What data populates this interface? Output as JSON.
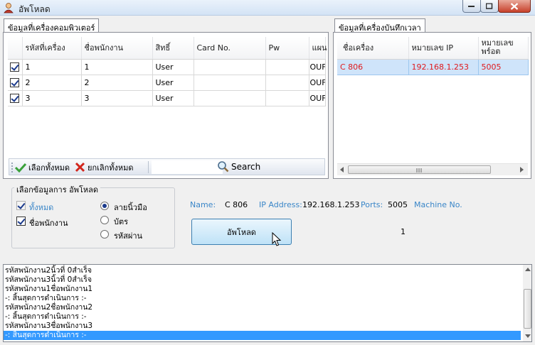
{
  "window": {
    "title": "อัพโหลด"
  },
  "left_tab": {
    "label": "ข้อมูลที่เครื่องคอมพิวเตอร์",
    "columns": [
      "",
      "รหัสที่เครื่อง",
      "ชื่อพนักงาน",
      "สิทธิ์",
      "Card No.",
      "Pw",
      "แผน"
    ],
    "rows": [
      {
        "checked": true,
        "id": "1",
        "name": "1",
        "role": "User",
        "card": "",
        "pw": "",
        "dept": "OUF"
      },
      {
        "checked": true,
        "id": "2",
        "name": "2",
        "role": "User",
        "card": "",
        "pw": "",
        "dept": "OUF"
      },
      {
        "checked": true,
        "id": "3",
        "name": "3",
        "role": "User",
        "card": "",
        "pw": "",
        "dept": "OUF"
      }
    ],
    "toolbar": {
      "select_all": "เลือกทั้งหมด",
      "deselect_all": "ยกเลิกทั้งหมด",
      "search_value": "",
      "search": "Search"
    }
  },
  "right_tab": {
    "label": "ข้อมูลที่เครื่องบันทึกเวลา",
    "columns": [
      "ชื่อเครื่อง",
      "หมายเลข IP",
      "หมายเลขพร์อต"
    ],
    "rows": [
      {
        "name": "C 806",
        "ip": "192.168.1.253",
        "port": "5005"
      }
    ]
  },
  "options": {
    "title": "เลือกข้อมูลการ อัพโหลด",
    "check_all": "ทั้งหมด",
    "check_name": "ชื่อพนักงาน",
    "radio_finger": "ลายนิ้วมือ",
    "radio_card": "บัตร",
    "radio_password": "รหัสผ่าน"
  },
  "info": {
    "name_label": "Name:",
    "name_value": "C 806",
    "ip_label": "IP Address:",
    "ip_value": "192.168.1.253",
    "port_label": "Ports:",
    "port_value": "5005",
    "machine_label": "Machine No.",
    "machine_value": "1"
  },
  "upload_button": "อัพโหลด",
  "log": [
    "รหัสพนักงาน2นิ้วที่ 0สำเร็จ",
    "รหัสพนักงาน3นิ้วที่ 0สำเร็จ",
    "รหัสพนักงาน1ชื่อพนักงาน1",
    "-: สิ้นสุดการดำเนินการ :-",
    "รหัสพนักงาน2ชื่อพนักงาน2",
    "-: สิ้นสุดการดำเนินการ :-",
    "รหัสพนักงาน3ชื่อพนักงาน3",
    "-: สิ้นสุดการดำเนินการ :-"
  ],
  "colors": {
    "selected_row_text": "#e0191d",
    "selected_row_bg": "#cfe4fa",
    "info_label": "#3a86c8",
    "log_selected": "#3399ff"
  }
}
